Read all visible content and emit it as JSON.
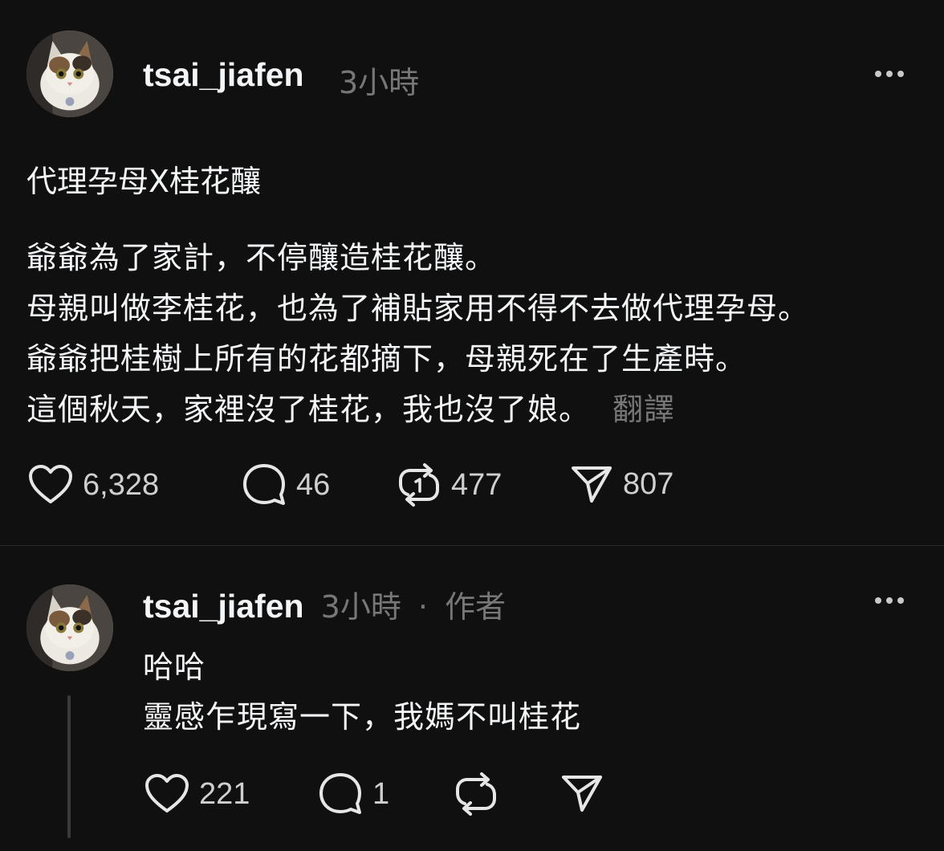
{
  "post": {
    "username": "tsai_jiafen",
    "time": "3小時",
    "title": "代理孕母X桂花釀",
    "body_lines": [
      "爺爺為了家計，不停釀造桂花釀。",
      "母親叫做李桂花，也為了補貼家用不得不去做代理孕母。",
      "爺爺把桂樹上所有的花都摘下，母親死在了生產時。",
      "這個秋天，家裡沒了桂花，我也沒了娘。"
    ],
    "translate_label": "翻譯",
    "likes": "6,328",
    "comments": "46",
    "reposts": "477",
    "shares": "807",
    "more_icon": "ellipsis-icon"
  },
  "reply": {
    "username": "tsai_jiafen",
    "time": "3小時",
    "separator": "·",
    "author_badge": "作者",
    "lines": [
      "哈哈",
      "靈感乍現寫一下，我媽不叫桂花"
    ],
    "likes": "221",
    "comments": "1",
    "more_icon": "ellipsis-icon"
  },
  "icons": {
    "like": "heart-icon",
    "comment": "comment-bubble-icon",
    "repost": "repost-icon",
    "share": "send-icon"
  },
  "colors": {
    "background": "#101010",
    "primary_text": "#f3f5f7",
    "secondary_text": "#777777"
  }
}
